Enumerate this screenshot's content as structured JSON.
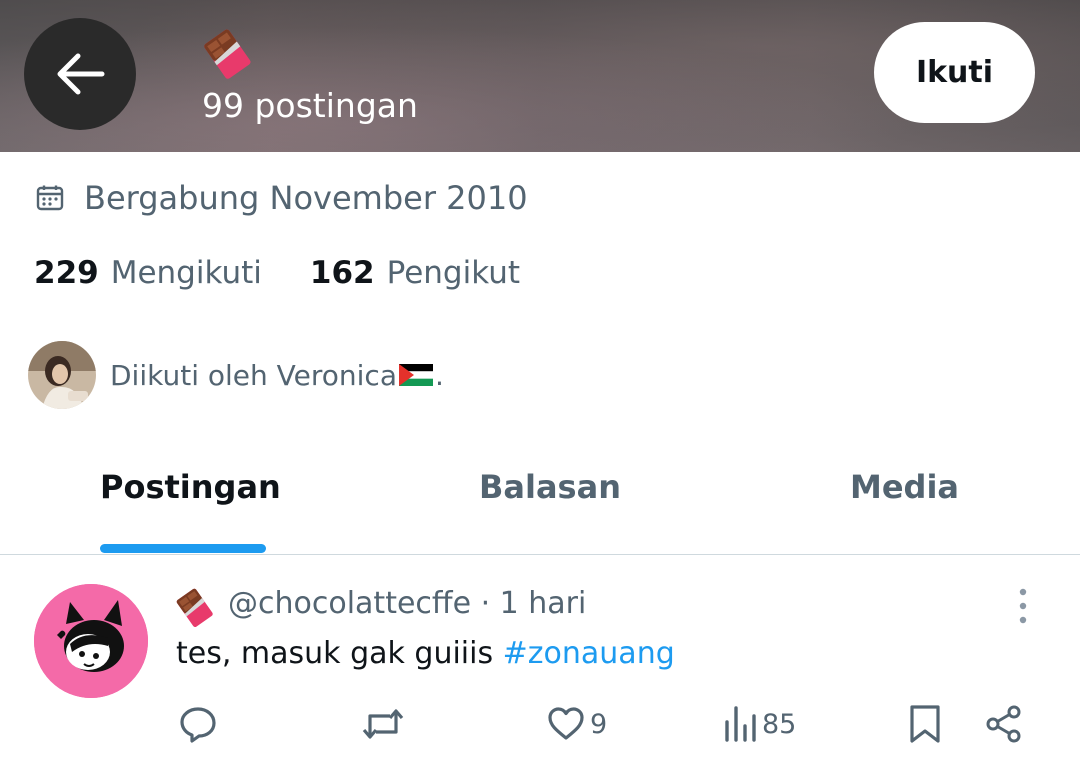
{
  "header": {
    "back_icon": "arrow-left-icon",
    "name_emoji": "chocolate-bar-emoji",
    "post_count": "99 postingan",
    "follow_label": "Ikuti"
  },
  "profile": {
    "joined_icon": "calendar-icon",
    "joined": "Bergabung November 2010",
    "following_count": "229",
    "following_label": "Mengikuti",
    "followers_count": "162",
    "followers_label": "Pengikut",
    "followed_by_text": "Diikuti oleh Veronica",
    "followed_by_suffix": "."
  },
  "tabs": [
    {
      "label": "Postingan",
      "active": true
    },
    {
      "label": "Balasan",
      "active": false
    },
    {
      "label": "Media",
      "active": false
    }
  ],
  "post": {
    "handle": "@chocolattecffe",
    "separator": " · ",
    "time": "1 hari",
    "text": "tes, masuk gak guiiis ",
    "hashtag": "#zonauang",
    "actions": {
      "reply_icon": "reply-icon",
      "repost_icon": "repost-icon",
      "like_icon": "heart-icon",
      "like_count": "9",
      "views_icon": "views-icon",
      "views_count": "85",
      "bookmark_icon": "bookmark-icon",
      "share_icon": "share-icon"
    }
  },
  "colors": {
    "accent": "#1d9bf0",
    "secondary_text": "#536471",
    "primary_text": "#0f1419",
    "avatar_bg": "#f46aa8"
  }
}
